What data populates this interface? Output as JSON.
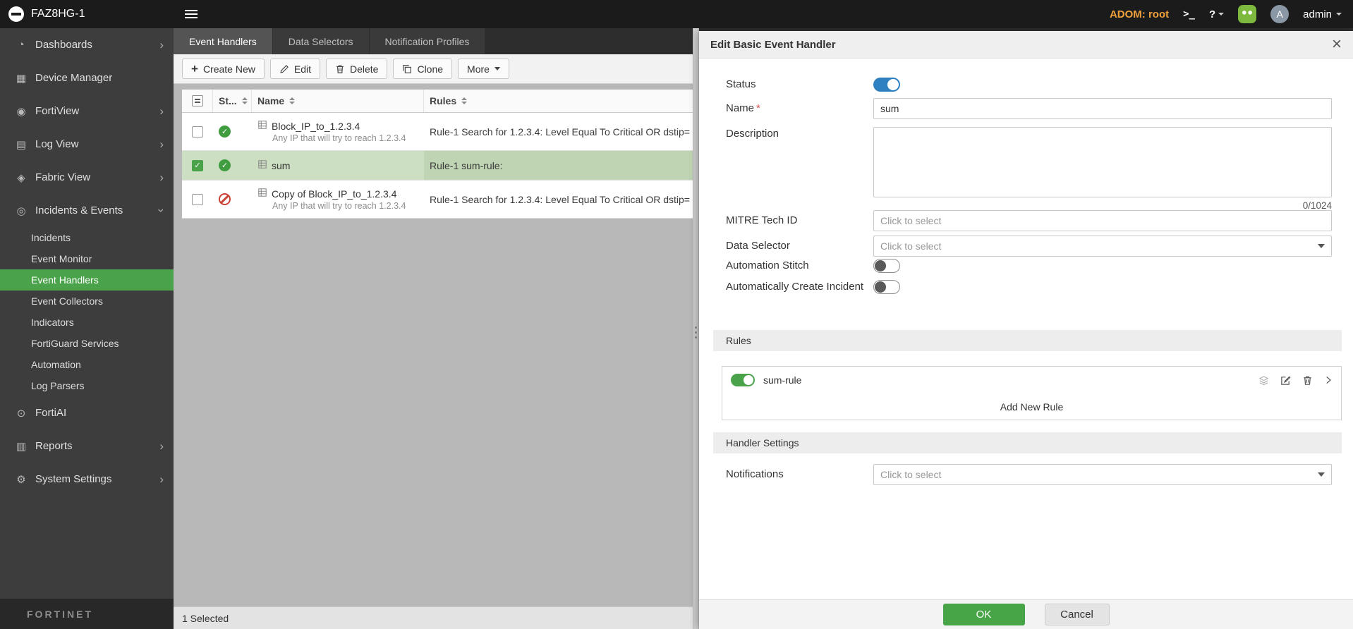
{
  "topbar": {
    "app_name": "FAZ8HG-1",
    "adom_label": "ADOM: root",
    "user": "admin",
    "avatar_letter": "A"
  },
  "icons": {
    "dashboard": "◔",
    "device_manager": "▦",
    "fortiview": "◉",
    "log_view": "▤",
    "fabric_view": "◈",
    "incidents_events": "◎",
    "fortiai": "⊙",
    "reports": "▥",
    "system_settings": "⚙",
    "chevron_right": "›",
    "check": "✓",
    "close": "×",
    "help": "?",
    "cli": ">_"
  },
  "colors": {
    "accent_green": "#4aa34a",
    "toggle_on_blue": "#2e80c0",
    "adom_orange": "#f0a13c",
    "status_enabled": "#3f9c3f",
    "status_disabled": "#cc4135",
    "selected_row": "#ccdfc2"
  },
  "sidebar": {
    "items": [
      {
        "label": "Dashboards"
      },
      {
        "label": "Device Manager"
      },
      {
        "label": "FortiView"
      },
      {
        "label": "Log View"
      },
      {
        "label": "Fabric View"
      },
      {
        "label": "Incidents & Events"
      },
      {
        "label": "FortiAI"
      },
      {
        "label": "Reports"
      },
      {
        "label": "System Settings"
      }
    ],
    "sub_items": [
      {
        "label": "Incidents"
      },
      {
        "label": "Event Monitor"
      },
      {
        "label": "Event Handlers"
      },
      {
        "label": "Event Collectors"
      },
      {
        "label": "Indicators"
      },
      {
        "label": "FortiGuard Services"
      },
      {
        "label": "Automation"
      },
      {
        "label": "Log Parsers"
      }
    ],
    "active_sub_item": "Event Handlers",
    "footer_logo": "FORTINET"
  },
  "tabs": [
    {
      "label": "Event Handlers"
    },
    {
      "label": "Data Selectors"
    },
    {
      "label": "Notification Profiles"
    }
  ],
  "toolbar": {
    "buttons": [
      {
        "label": "Create New"
      },
      {
        "label": "Edit"
      },
      {
        "label": "Delete"
      },
      {
        "label": "Clone"
      },
      {
        "label": "More"
      }
    ]
  },
  "table": {
    "columns": {
      "status": "St...",
      "name": "Name",
      "rules": "Rules"
    },
    "rows": [
      {
        "status": "enabled",
        "checked": false,
        "selected": false,
        "name": "Block_IP_to_1.2.3.4",
        "description": "Any IP that will try to reach 1.2.3.4",
        "rules": "Rule-1 Search for 1.2.3.4: Level Equal To Critical OR dstip="
      },
      {
        "status": "enabled",
        "checked": true,
        "selected": true,
        "name": "sum",
        "description": "",
        "rules": "Rule-1 sum-rule:"
      },
      {
        "status": "disabled",
        "checked": false,
        "selected": false,
        "name": "Copy of Block_IP_to_1.2.3.4",
        "description": "Any IP that will try to reach 1.2.3.4",
        "rules": "Rule-1 Search for 1.2.3.4: Level Equal To Critical OR dstip="
      }
    ]
  },
  "statusbar": {
    "selected_count": "1 Selected"
  },
  "panel": {
    "title": "Edit Basic Event Handler",
    "labels": {
      "status": "Status",
      "name": "Name",
      "required_mark": "*",
      "description": "Description",
      "mitre": "MITRE Tech ID",
      "data_selector": "Data Selector",
      "automation_stitch": "Automation Stitch",
      "auto_create_incident": "Automatically Create Incident",
      "notifications": "Notifications"
    },
    "values": {
      "name": "sum",
      "description_counter": "0/1024",
      "mitre_placeholder": "Click to select",
      "data_selector_placeholder": "Click to select",
      "notifications_placeholder": "Click to select"
    },
    "rules": {
      "header": "Rules",
      "rule_name": "sum-rule",
      "add_new": "Add New Rule"
    },
    "handler_settings_header": "Handler Settings",
    "buttons": {
      "ok": "OK",
      "cancel": "Cancel"
    }
  }
}
